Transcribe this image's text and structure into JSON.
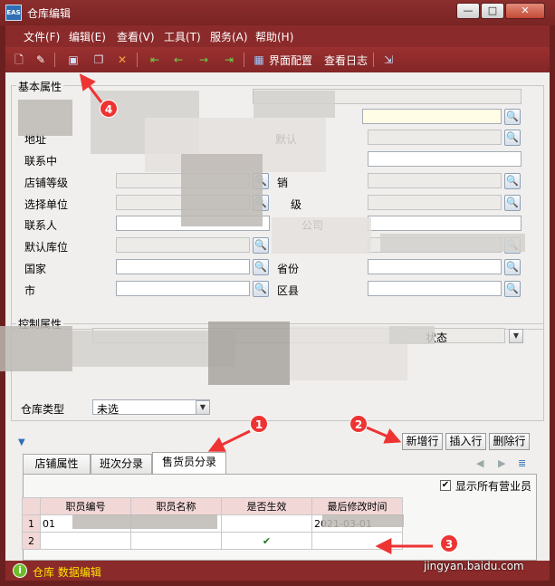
{
  "window": {
    "title": "仓库编辑",
    "logo": "EAS",
    "min_glyph": "—",
    "max_glyph": "□",
    "close_glyph": "✕"
  },
  "menu": [
    "文件(F)",
    "编辑(E)",
    "查看(V)",
    "工具(T)",
    "服务(A)",
    "帮助(H)"
  ],
  "toolbar": {
    "ui_config": "界面配置",
    "view_log": "查看日志",
    "icons": [
      "new-icon",
      "edit-icon",
      "save-icon",
      "copy-icon",
      "delete-icon",
      "first-icon",
      "prev-icon",
      "next-icon",
      "last-icon",
      "ui-config-icon",
      "exit-icon"
    ]
  },
  "basic": {
    "title": "基本属性",
    "labels": {
      "address": "地址",
      "contact_mid": "联系中",
      "store_level": "店铺等级",
      "select_unit": "选择单位",
      "contact_person": "联系人",
      "default_location": "默认库位",
      "country": "国家",
      "city": "市",
      "default_right": "默认",
      "sales": "销",
      "level": "级",
      "company": "公司",
      "province": "省份",
      "district": "区县"
    }
  },
  "control": {
    "title": "控制属性",
    "status_label": "状态",
    "warehouse_type_label": "仓库类型",
    "warehouse_type_value": "未选"
  },
  "actions": {
    "add_row": "新增行",
    "insert_row": "插入行",
    "delete_row": "删除行"
  },
  "tabs": [
    "店铺属性",
    "班次分录",
    "售货员分录"
  ],
  "show_all": "显示所有营业员",
  "grid": {
    "headers": [
      "职员编号",
      "职员名称",
      "是否生效",
      "最后修改时间"
    ],
    "rows": [
      {
        "no": "1",
        "code": "01",
        "name": "",
        "active": "",
        "time": "2021-03-01"
      },
      {
        "no": "2",
        "code": "",
        "name": "",
        "active": "✔",
        "time": ""
      }
    ]
  },
  "status": {
    "text": "仓库 数据编辑",
    "icon": "info-icon"
  },
  "annotations": [
    "1",
    "2",
    "3",
    "4"
  ],
  "watermark": "jingyan.baidu.com"
}
